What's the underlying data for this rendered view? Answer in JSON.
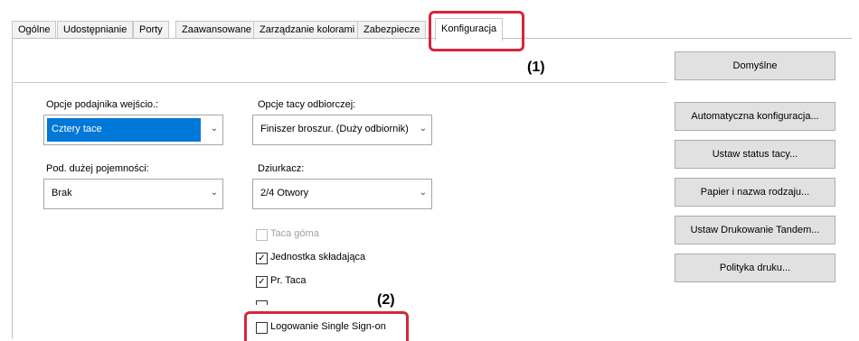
{
  "tabs": [
    "Ogólne",
    "Udostępnianie",
    "Porty",
    "Zaawansowane",
    "Zarządzanie kolorami",
    "Zabezpiecze",
    "Konfiguracja"
  ],
  "left": {
    "input_options_label": "Opcje podajnika wejścio.:",
    "input_options_value": "Cztery tace",
    "high_capacity_label": "Pod. dużej pojemności:",
    "high_capacity_value": "Brak"
  },
  "middle": {
    "output_tray_label": "Opcje tacy odbiorczej:",
    "output_tray_value": "Finiszer broszur. (Duży odbiornik)",
    "puncher_label": "Dziurkacz:",
    "puncher_value": "2/4 Otwory"
  },
  "checkboxes": [
    {
      "label": "Taca góma",
      "checked": false,
      "disabled": true
    },
    {
      "label": "Jednostka składająca",
      "checked": true,
      "disabled": false
    },
    {
      "label": "Pr. Taca",
      "checked": true,
      "disabled": false
    },
    {
      "label": "Logowanie Single Sign-on",
      "checked": false,
      "disabled": false
    }
  ],
  "buttons": {
    "default": "Domyślne",
    "auto_config": "Automatyczna konfiguracja...",
    "tray_status": "Ustaw status tacy...",
    "paper_name": "Papier i nazwa rodzaju...",
    "tandem": "Ustaw Drukowanie Tandem...",
    "print_policy": "Polityka druku..."
  },
  "callouts": {
    "one": "(1)",
    "two": "(2)"
  }
}
